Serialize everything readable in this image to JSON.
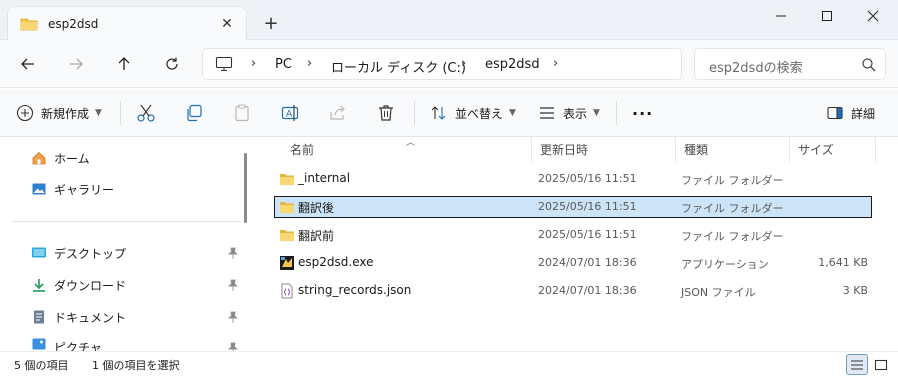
{
  "window": {
    "tab_title": "esp2dsd",
    "new_tab_label": "+",
    "close_tab_label": "✕"
  },
  "address": {
    "breadcrumbs": [
      "PC",
      "ローカル ディスク (C:)",
      "esp2dsd"
    ],
    "separator": ">"
  },
  "search": {
    "placeholder": "esp2dsdの検索"
  },
  "toolbar": {
    "new_label": "新規作成",
    "sort_label": "並べ替え",
    "view_label": "表示",
    "more_label": "···",
    "details_label": "詳細"
  },
  "sidebar": {
    "items": [
      {
        "label": "ホーム",
        "icon": "home-icon",
        "pinned": false
      },
      {
        "label": "ギャラリー",
        "icon": "gallery-icon",
        "pinned": false
      },
      {
        "label": "デスクトップ",
        "icon": "desktop-icon",
        "pinned": true
      },
      {
        "label": "ダウンロード",
        "icon": "download-icon",
        "pinned": true
      },
      {
        "label": "ドキュメント",
        "icon": "documents-icon",
        "pinned": true
      },
      {
        "label": "ピクチャ",
        "icon": "pictures-icon",
        "pinned": true
      }
    ]
  },
  "columns": {
    "name": "名前",
    "date": "更新日時",
    "type": "種類",
    "size": "サイズ"
  },
  "files": [
    {
      "name": "_internal",
      "date": "2025/05/16 11:51",
      "type": "ファイル フォルダー",
      "size": "",
      "icon": "folder-icon",
      "selected": false
    },
    {
      "name": "翻訳後",
      "date": "2025/05/16 11:51",
      "type": "ファイル フォルダー",
      "size": "",
      "icon": "folder-icon",
      "selected": true
    },
    {
      "name": "翻訳前",
      "date": "2025/05/16 11:51",
      "type": "ファイル フォルダー",
      "size": "",
      "icon": "folder-icon",
      "selected": false
    },
    {
      "name": "esp2dsd.exe",
      "date": "2024/07/01 18:36",
      "type": "アプリケーション",
      "size": "1,641 KB",
      "icon": "exe-icon",
      "selected": false
    },
    {
      "name": "string_records.json",
      "date": "2024/07/01 18:36",
      "type": "JSON ファイル",
      "size": "3 KB",
      "icon": "json-file-icon",
      "selected": false
    }
  ],
  "status": {
    "item_count": "5 個の項目",
    "selected_count": "1 個の項目を選択"
  },
  "colors": {
    "accent": "#0067c0",
    "selection": "#cce4f7",
    "folder": "#f2c94c"
  }
}
